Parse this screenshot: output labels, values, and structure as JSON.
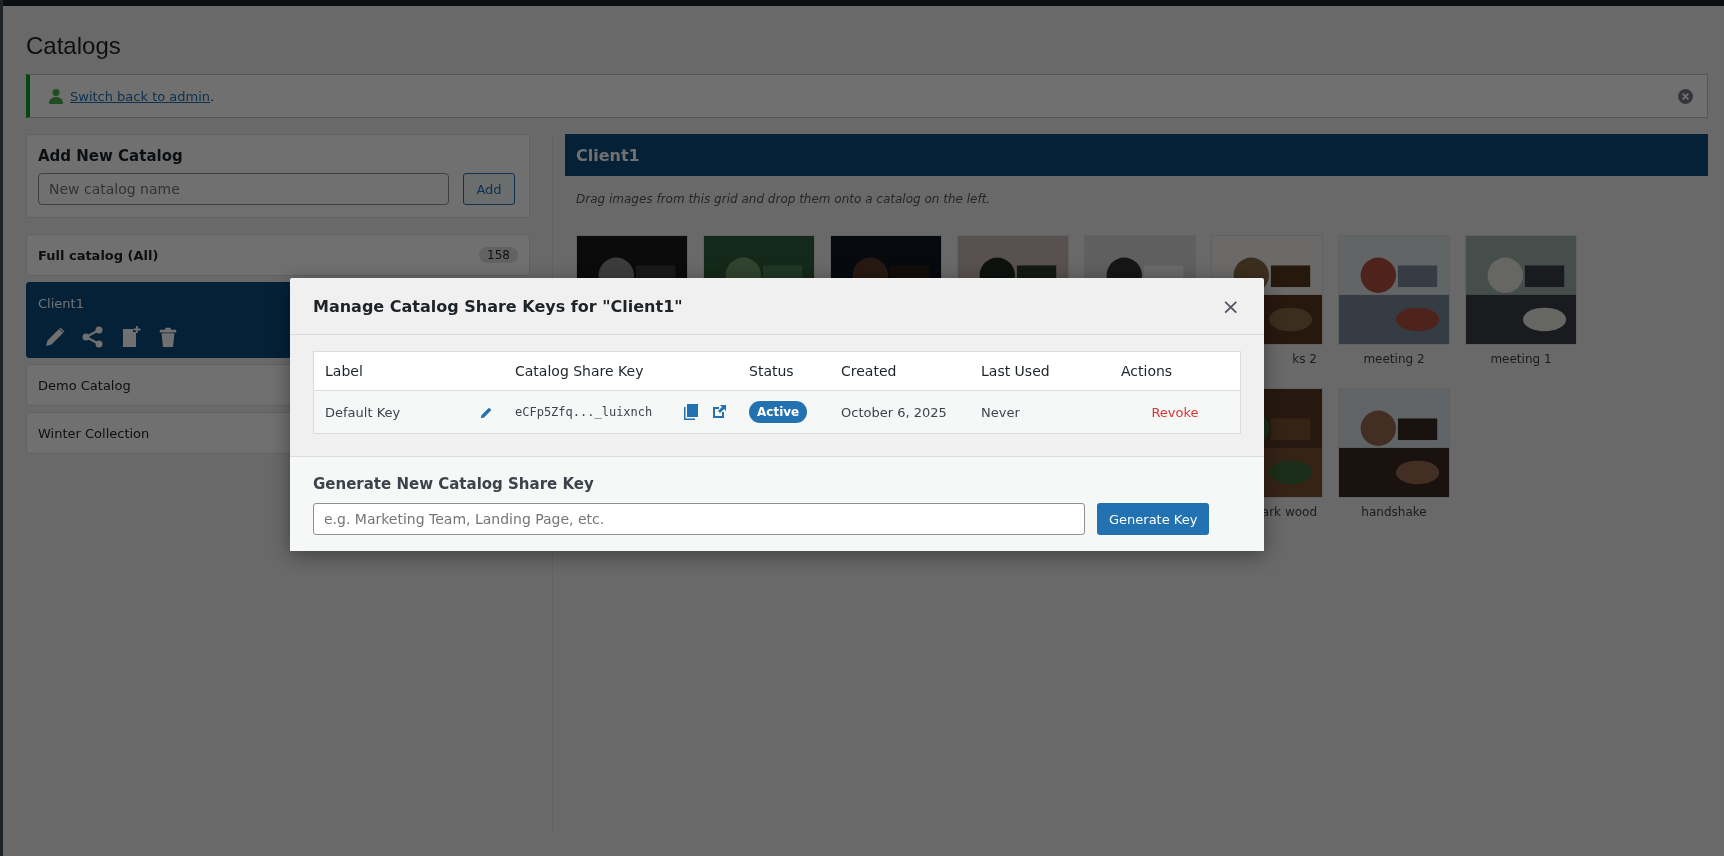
{
  "page_title": "Catalogs",
  "notice": {
    "link": "Switch back to admin",
    "suffix": "."
  },
  "add_catalog": {
    "title": "Add New Catalog",
    "placeholder": "New catalog name",
    "button": "Add"
  },
  "catalogs": [
    {
      "name": "Full catalog (All)",
      "kind": "all",
      "count": "158",
      "selected": false
    },
    {
      "name": "Client1",
      "kind": "catalog",
      "selected": true
    },
    {
      "name": "Demo Catalog",
      "kind": "catalog",
      "selected": false
    },
    {
      "name": "Winter Collection",
      "kind": "catalog",
      "selected": false
    }
  ],
  "catalog_panel": {
    "title": "Client1",
    "hint": "Drag images from this grid and drop them onto a catalog on the left.",
    "images": [
      {
        "kind": "picture"
      },
      {
        "kind": "picture"
      },
      {
        "kind": "picture"
      },
      {
        "kind": "picture"
      },
      {
        "kind": "picture"
      },
      {
        "kind": "picture",
        "caption": "ks 2",
        "cut": true
      },
      {
        "kind": "picture",
        "caption": "meeting 2",
        "cut": false
      },
      {
        "kind": "picture",
        "caption": "meeting 1",
        "cut": false
      },
      {
        "kind": "picture",
        "caption": "ark wood",
        "cut": true
      },
      {
        "kind": "picture",
        "caption": "handshake",
        "cut": false
      }
    ]
  },
  "modal": {
    "title": "Manage Catalog Share Keys for \"Client1\"",
    "close": "×",
    "columns": [
      "Label",
      "Catalog Share Key",
      "Status",
      "Created",
      "Last Used",
      "Actions"
    ],
    "keys": [
      {
        "label": "Default Key",
        "key": "eCFp5Zfq..._luixnch",
        "status": "Active",
        "active": true,
        "created": "October 6, 2025",
        "last_used": "Never",
        "action": "Revoke"
      }
    ],
    "generate": {
      "title": "Generate New Catalog Share Key",
      "placeholder": "e.g. Marketing Team, Landing Page, etc.",
      "button": "Generate Key"
    }
  }
}
